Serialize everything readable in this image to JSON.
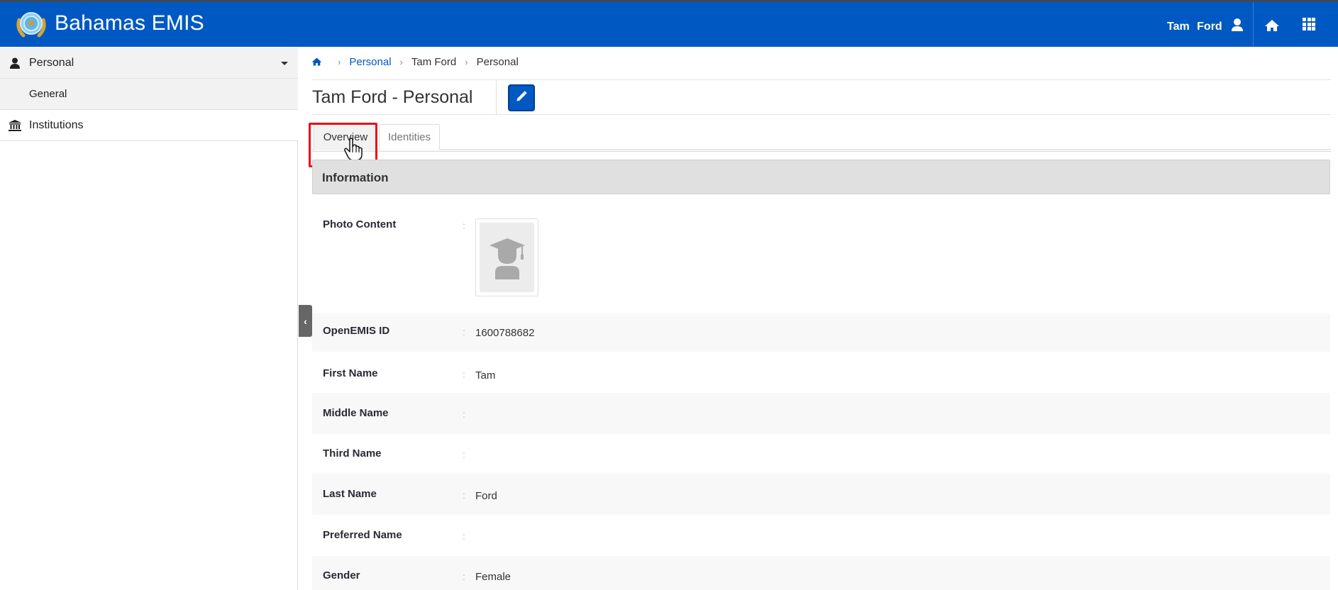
{
  "header": {
    "app_title": "Bahamas EMIS",
    "user_name": "Tam  Ford",
    "icons": [
      "logo-emblem",
      "user-icon",
      "home-icon",
      "apps-grid-icon"
    ],
    "brand_color": "#0059c2"
  },
  "sidebar": {
    "items": [
      {
        "label": "Personal",
        "icon": "user-icon",
        "expanded": true
      },
      {
        "label": "General",
        "icon": null,
        "sub": true
      },
      {
        "label": "Institutions",
        "icon": "institution-icon"
      }
    ]
  },
  "breadcrumb": {
    "items": [
      "Personal",
      "Tam Ford",
      "Personal"
    ]
  },
  "page": {
    "title": "Tam Ford - Personal",
    "edit_icon": "pencil-icon"
  },
  "tabs": [
    {
      "label": "Overview",
      "active": true
    },
    {
      "label": "Identities",
      "active": false
    }
  ],
  "section": {
    "title": "Information"
  },
  "fields": {
    "photo": {
      "label": "Photo Content",
      "value": ""
    },
    "rows": [
      {
        "label": "OpenEMIS ID",
        "value": "1600788682"
      },
      {
        "label": "First Name",
        "value": "Tam"
      },
      {
        "label": "Middle Name",
        "value": ""
      },
      {
        "label": "Third Name",
        "value": ""
      },
      {
        "label": "Last Name",
        "value": "Ford"
      },
      {
        "label": "Preferred Name",
        "value": ""
      },
      {
        "label": "Gender",
        "value": "Female"
      }
    ],
    "separator": ":"
  },
  "annotation": {
    "highlight_color": "#e8101a",
    "highlighted": "Overview tab"
  }
}
